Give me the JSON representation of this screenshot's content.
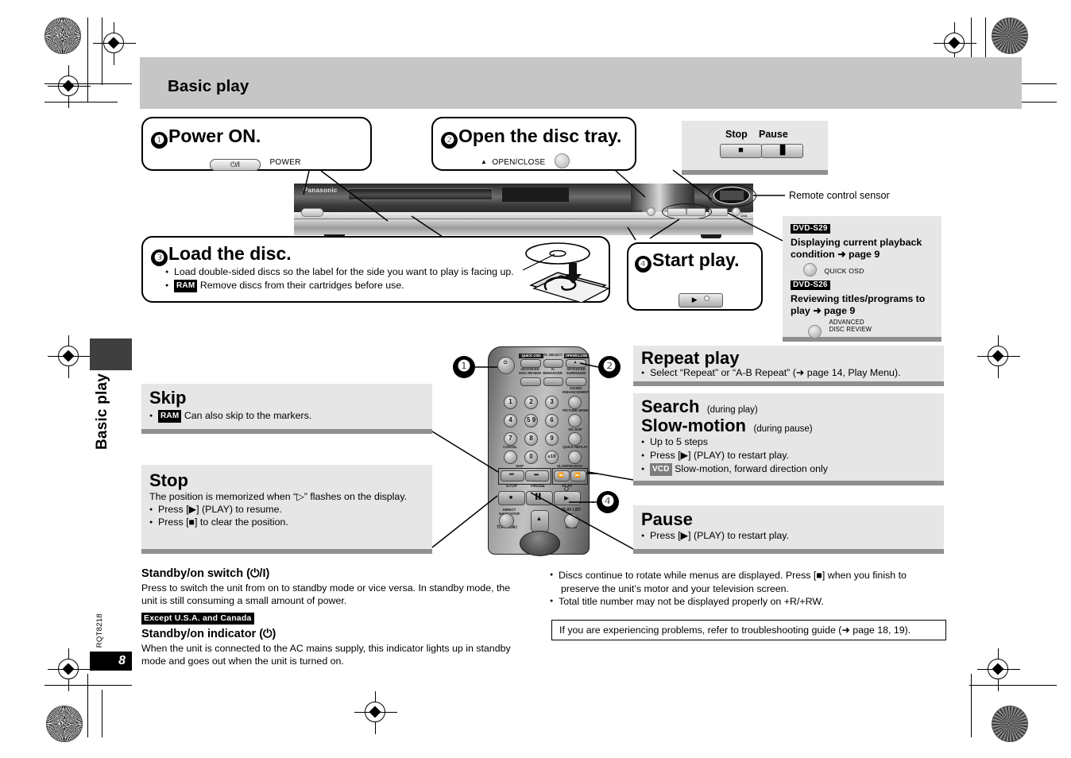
{
  "page": {
    "header_title": "Basic play",
    "side_tab_label": "Basic play",
    "doc_code": "RQT8218",
    "page_number": "8"
  },
  "steps": [
    {
      "num": "❶",
      "title": "Power ON.",
      "button_label": "POWER",
      "button_glyph": "⏻/I"
    },
    {
      "num": "❷",
      "title": "Open the disc tray.",
      "button_label": "OPEN/CLOSE",
      "button_glyph": "▲"
    },
    {
      "num": "❸",
      "title": "Load the disc.",
      "bullets": [
        {
          "badge": "",
          "text": "Load double-sided discs so the label for the side you want to play is facing up."
        },
        {
          "badge": "RAM",
          "text": "Remove discs from their cartridges before use."
        }
      ]
    },
    {
      "num": "❹",
      "title": "Start play.",
      "button_glyph": "▶"
    }
  ],
  "stop_pause_panel": {
    "stop_label": "Stop",
    "pause_label": "Pause",
    "stop_glyph": "■",
    "pause_glyph": "▐▌"
  },
  "remote_sensor_label": "Remote control sensor",
  "model_panel": {
    "entries": [
      {
        "badge": "DVD-S29",
        "heading_line1": "Displaying current playback",
        "heading_line2": "condition ➜ page 9",
        "button_label_line1": "QUICK OSD",
        "button_label_line2": ""
      },
      {
        "badge": "DVD-S26",
        "heading_line1": "Reviewing titles/programs to",
        "heading_line2": "play ➜ page 9",
        "button_label_line1": "ADVANCED",
        "button_label_line2": "DISC REVIEW"
      }
    ]
  },
  "left_sections": [
    {
      "title": "Skip",
      "lines": [
        {
          "badge": "RAM",
          "text": "Can also skip to the markers.",
          "bullet": true
        }
      ]
    },
    {
      "title": "Stop",
      "intro": "The position is memorized when “▷” flashes on the display.",
      "lines": [
        {
          "badge": "",
          "text": "Press [▶] (PLAY) to resume.",
          "bullet": true
        },
        {
          "badge": "",
          "text": "Press [■] to clear the position.",
          "bullet": true
        }
      ]
    }
  ],
  "right_sections": [
    {
      "title": "Repeat play",
      "subtitle": "",
      "lines": [
        {
          "badge": "",
          "text": "Select “Repeat” or “A-B Repeat” (➜ page 14, Play Menu).",
          "bullet": true
        }
      ]
    },
    {
      "title": "Search",
      "subtitle": "(during play)",
      "title2": "Slow-motion",
      "subtitle2": "(during pause)",
      "lines": [
        {
          "badge": "",
          "text": "Up to 5 steps",
          "bullet": true
        },
        {
          "badge": "",
          "text": "Press [▶] (PLAY) to restart play.",
          "bullet": true
        },
        {
          "badge": "VCD",
          "text": "Slow-motion, forward direction only",
          "bullet": true
        }
      ]
    },
    {
      "title": "Pause",
      "subtitle": "",
      "lines": [
        {
          "badge": "",
          "text": "Press [▶] (PLAY) to restart play.",
          "bullet": true
        }
      ]
    }
  ],
  "bottom_left": {
    "h1": "Standby/on switch (⏻/I)",
    "p1_line1": "Press to switch the unit from on to standby mode or vice versa. In standby mode, the",
    "p1_line2": "unit is still consuming a small amount of power.",
    "region_badge": "Except U.S.A. and Canada",
    "h2": "Standby/on indicator (⏻)",
    "p2_line1": "When the unit is connected to the AC mains supply, this indicator lights up in standby",
    "p2_line2": "mode and goes out when the unit is turned on."
  },
  "bottom_right": {
    "bullets": [
      {
        "line1": "Discs continue to rotate while menus are displayed. Press [■] when you finish to",
        "line2": "preserve the unit’s motor and your television screen."
      },
      {
        "line1": "Total title number may not be displayed properly on +R/+RW.",
        "line2": ""
      }
    ],
    "tip": "If you are experiencing problems, refer to troubleshooting guide (➜ page 18, 19)."
  },
  "remote": {
    "top_labels": [
      {
        "text": "QUICK OSD",
        "inverted": true
      },
      {
        "text": "FL SELECT",
        "inverted": false
      },
      {
        "text": "OPEN/CLOSE",
        "inverted": true
      }
    ],
    "row2_labels": [
      "ADVANCED\nDISC REVIEW",
      "AI\nENHANCER",
      "ADVANCED\nSURROUND"
    ],
    "right_labels": [
      "SOUND\nENHANCEMENT",
      "PICTURE MODE",
      "DN SKIP",
      "QUICK REPLAY"
    ],
    "numbers": [
      "1",
      "2",
      "3",
      "4",
      "5 9",
      "6",
      "7",
      "8",
      "9",
      "",
      "0",
      "≥10"
    ],
    "cancel_label": "CANCEL",
    "skip_label": "SKIP",
    "slow_search_label": "SLOW/SEARCH",
    "transport_labels": [
      "STOP",
      "PAUSE",
      "PLAY"
    ],
    "bottom_labels": [
      "DIRECT NAVIGATOR",
      "TOP MENU",
      "PLAY LIST",
      "MENU"
    ]
  },
  "colors": {
    "band": "#c6c6c6",
    "panel": "#e6e6e6",
    "panel_shadow": "#8f8f8f",
    "ink": "#000000",
    "tab": "#3f3f3f"
  }
}
